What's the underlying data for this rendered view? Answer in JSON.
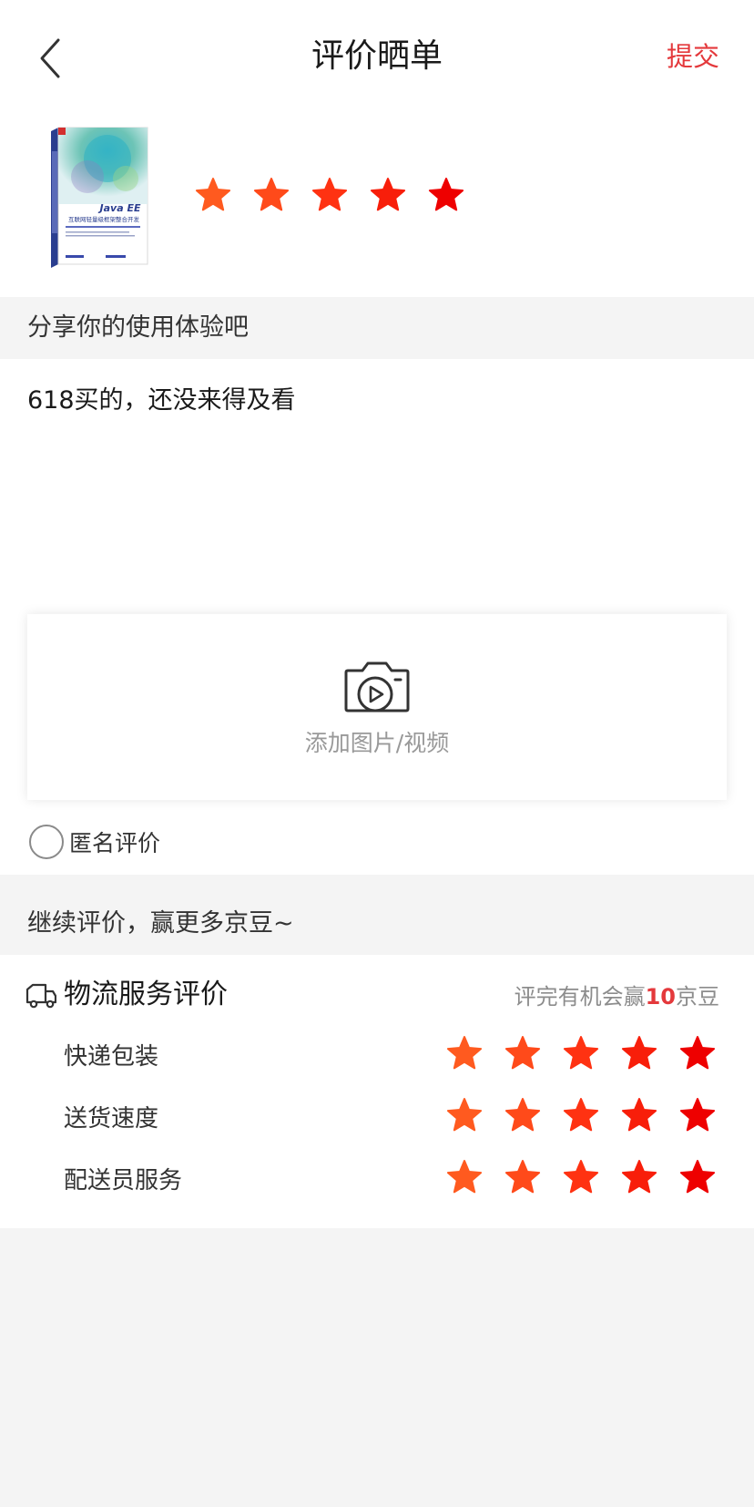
{
  "header": {
    "title": "评价晒单",
    "submit_label": "提交"
  },
  "product": {
    "book_cover": {
      "title": "Java EE",
      "subtitle": "互联网轻量级框架整合开发"
    },
    "rating": 5,
    "max_rating": 5
  },
  "comment": {
    "section_title": "分享你的使用体验吧",
    "text": "618买的，还没来得及看",
    "upload_label": "添加图片/视频",
    "anonymous_label": "匿名评价",
    "anonymous_checked": false
  },
  "more": {
    "section_title": "继续评价，赢更多京豆~"
  },
  "logistics": {
    "title": "物流服务评价",
    "bonus_prefix": "评完有机会赢",
    "bonus_amount": "10",
    "bonus_suffix": "京豆",
    "rows": [
      {
        "label": "快递包装",
        "rating": 5
      },
      {
        "label": "送货速度",
        "rating": 5
      },
      {
        "label": "配送员服务",
        "rating": 5
      }
    ]
  },
  "colors": {
    "accent": "#e4393c",
    "star_gradient": [
      "#ff5a1f",
      "#ff4a1a",
      "#ff3212",
      "#f81e0a",
      "#ee0000"
    ]
  }
}
